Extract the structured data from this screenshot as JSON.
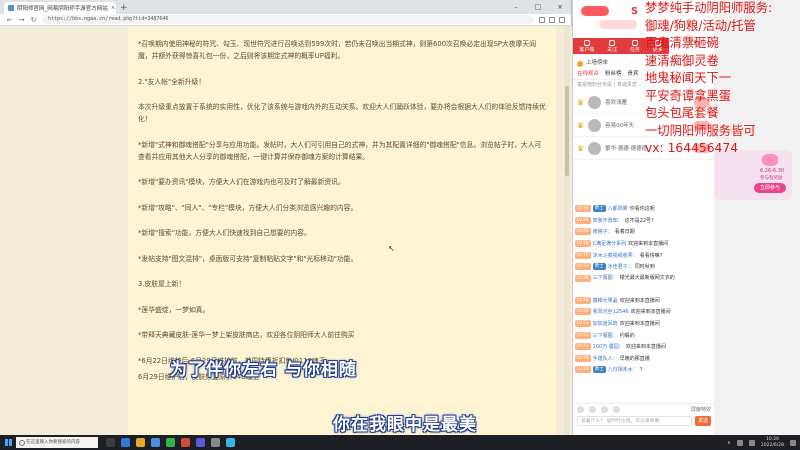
{
  "browser": {
    "tab_title": "阴阳师官网_网易阴阳师手游官方网站",
    "url": "https://bbs.ngaa.cn/read.php?tid=3487646"
  },
  "article": {
    "paragraphs": [
      "*召唤期内使用神秘的符咒、勾玉、现世符咒进行召唤达到599次时，若仍未召唤出当期式神，则第600次召唤必定出现SP大夜摩天阎魔，并额外获得惊喜礼包一份，之后则将该期定式神的概率UP福利。",
      "2.\"友人帐\"全新升级！",
      "本次升级重点放置于系统的实用性，优化了该系统与游戏内外的互动关系。欢迎大人们踊跃体验，要办将会根据大人们的体验反馈持续优化！",
      "*新增\"式神和御魂搭配\"分享与应用功能。发帖时，大人们可引用自己的式神，并为其配置详细的\"御魂搭配\"信息。浏览帖子时，大人可查看并应用其他大人分享的御魂搭配，一键计算并保存御魂方案的计算结果。",
      "*新增\"要办资讯\"模块，方便大人们在游戏内也可及时了解最新资讯。",
      "*新增\"攻略\"、\"同人\"、\"专栏\"模块，方便大人们分类浏览感兴趣的内容。",
      "*新增\"搜索\"功能，方便大人们快速找到自己想要的内容。",
      "*发帖支持\"图文混排\"，桌面版可支持\"复制粘贴文字\"和\"光标移动\"功能。",
      "3.皮肤屋上新！",
      "*莲华盛绽，一梦如真。",
      "*带释天典藏皮肤-莲华一梦上架皮肤商店，欢迎各位阴阳师大人前往购买",
      "*6月22日维护后-6月29日维护前，首周特惠折扣售价118魂玉",
      "6月29日维护后，皮肤恢复原价148魂玉"
    ],
    "subtitle_line1": "为了伴你左右 与你相随",
    "subtitle_line2": "你在我眼中是最美"
  },
  "panel": {
    "nav": [
      "客户端",
      "关注",
      "任务",
      "更多"
    ],
    "side_label": "背包",
    "upper_label": "上墙榜单",
    "tabs": [
      "在线观众",
      "粉丝榜",
      "贵宾"
    ],
    "note": "富豪榜粉丝专属 | 真诚贵宾...",
    "ranks": [
      {
        "name": "喜欢浅雁"
      },
      {
        "name": "容易00年头"
      },
      {
        "name": "繁华·德德·德德德"
      }
    ],
    "chat": [
      {
        "lv": "LV.30",
        "badge": "勇士",
        "name": "八都阳雾",
        "text": "你看你这呢"
      },
      {
        "lv": "LV.24",
        "badge": "",
        "name": "知我不愿知：",
        "text": "这不是22号?"
      },
      {
        "lv": "LV.20",
        "badge": "",
        "name": "南狼子：",
        "text": "看着日期"
      },
      {
        "lv": "LV.18",
        "badge": "",
        "name": "C满足满分系列",
        "text": "欢迎来到本直播间"
      },
      {
        "lv": "LV.16",
        "badge": "",
        "name": "沐木斗菜视频收弄：",
        "text": "看看快嘛?"
      },
      {
        "lv": "LV.33",
        "badge": "勇士",
        "name": "冰佳君子：",
        "text": "同时秋到"
      },
      {
        "lv": "LV.26",
        "badge": "",
        "name": "三下瓶图：",
        "text": "楼光最大最新版网文衣的"
      },
      {
        "lv": "LV.18",
        "badge": "",
        "name": "鑫梯大果晶",
        "text": "欢迎来到本直播间"
      },
      {
        "lv": "LV.24",
        "badge": "",
        "name": "我骂光丝12546",
        "text": "欢迎来到本直播间"
      },
      {
        "lv": "LV.21",
        "badge": "",
        "name": "加加道凤鸣",
        "text": "欢迎来到本直播间"
      },
      {
        "lv": "LV.22",
        "badge": "",
        "name": "三下瓶图：",
        "text": "约躲的"
      },
      {
        "lv": "LV.21",
        "badge": "",
        "name": "100万·露园：",
        "text": "欢迎来到本直播间"
      },
      {
        "lv": "LV.18",
        "badge": "",
        "name": "手建队人：",
        "text": "早晚的那直播"
      },
      {
        "lv": "LV.20",
        "badge": "勇士",
        "name": "八日相未水：",
        "text": "?"
      }
    ],
    "checkbox_label": "屏蔽特效",
    "input_placeholder": "说着什么？ @时时注意，可以发弹幕",
    "send_label": "发送"
  },
  "promo": {
    "date": "6.26-6.30",
    "sub": "参与有奖励",
    "ribbon": "立即参与"
  },
  "overlay": {
    "lines": [
      "梦梦纯手动阴阳师服务:",
      "御魂/狗粮/活动/托管",
      "百鬼清票砸碗",
      "速清痴御灵卷",
      "地鬼秘闻天下一",
      "平安奇谭拿黑蛋",
      "包头包尾套餐",
      "一切阴阳师服务皆可",
      "vx: 164456474"
    ]
  },
  "taskbar": {
    "search_placeholder": "在这里输入你要搜索的内容",
    "time": "10:26",
    "date": "2022/6/28"
  },
  "colors": {
    "overlay_red": "#e01515",
    "page_bg": "#fdf4d3",
    "accent": "#e23b3b"
  }
}
